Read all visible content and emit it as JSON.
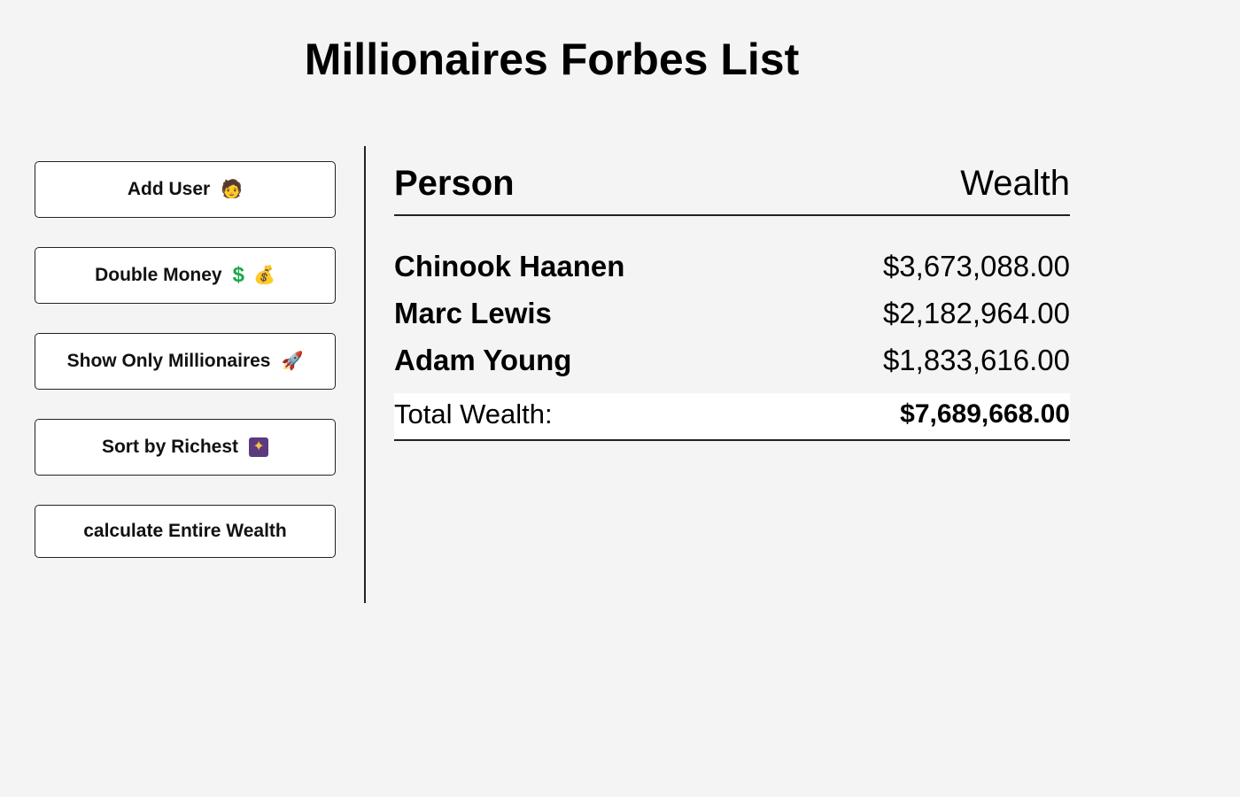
{
  "page": {
    "title": "Millionaires Forbes List"
  },
  "sidebar": {
    "buttons": [
      {
        "label": "Add User",
        "icons": [
          "🧑"
        ]
      },
      {
        "label": "Double Money",
        "icons": [
          "$",
          "💰"
        ]
      },
      {
        "label": "Show Only Millionaires",
        "icons": [
          "🚀"
        ]
      },
      {
        "label": "Sort by Richest",
        "icons": [
          "✦"
        ]
      },
      {
        "label": "calculate Entire Wealth",
        "icons": []
      }
    ]
  },
  "table": {
    "headers": {
      "person": "Person",
      "wealth": "Wealth"
    },
    "rows": [
      {
        "name": "Chinook Haanen",
        "wealth": "$3,673,088.00"
      },
      {
        "name": "Marc Lewis",
        "wealth": "$2,182,964.00"
      },
      {
        "name": "Adam Young",
        "wealth": "$1,833,616.00"
      }
    ],
    "total": {
      "label": "Total Wealth:",
      "value": "$7,689,668.00"
    }
  },
  "colors": {
    "background": "#f4f4f4",
    "button_background": "#ffffff",
    "border": "#222222"
  }
}
